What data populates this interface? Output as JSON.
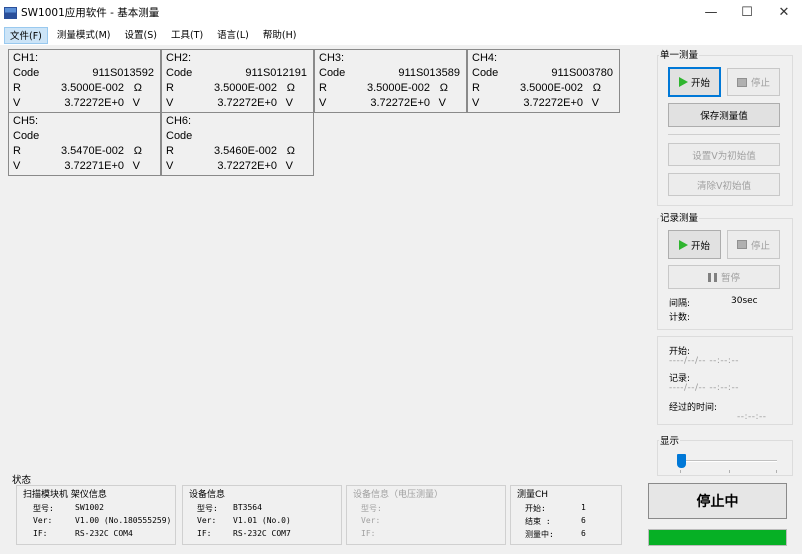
{
  "window": {
    "title": "SW1001应用软件 - 基本测量",
    "minimize_glyph": "—",
    "maximize_glyph": "☐",
    "close_glyph": "✕",
    "app_icon": "monitor-icon"
  },
  "menu": [
    "文件(F)",
    "测量模式(M)",
    "设置(S)",
    "工具(T)",
    "语言(L)",
    "帮助(H)"
  ],
  "channels": [
    {
      "name": "CH1:",
      "code_label": "Code",
      "code": "911S013592",
      "r_label": "R",
      "r": "3.5000E-002",
      "r_unit": "Ω",
      "v_label": "V",
      "v": "3.72272E+0",
      "v_unit": "V"
    },
    {
      "name": "CH2:",
      "code_label": "Code",
      "code": "911S012191",
      "r_label": "R",
      "r": "3.5000E-002",
      "r_unit": "Ω",
      "v_label": "V",
      "v": "3.72272E+0",
      "v_unit": "V"
    },
    {
      "name": "CH3:",
      "code_label": "Code",
      "code": "911S013589",
      "r_label": "R",
      "r": "3.5000E-002",
      "r_unit": "Ω",
      "v_label": "V",
      "v": "3.72272E+0",
      "v_unit": "V"
    },
    {
      "name": "CH4:",
      "code_label": "Code",
      "code": "911S003780",
      "r_label": "R",
      "r": "3.5000E-002",
      "r_unit": "Ω",
      "v_label": "V",
      "v": "3.72272E+0",
      "v_unit": "V"
    },
    {
      "name": "CH5:",
      "code_label": "Code",
      "code": "",
      "r_label": "R",
      "r": "3.5470E-002",
      "r_unit": "Ω",
      "v_label": "V",
      "v": "3.72271E+0",
      "v_unit": "V"
    },
    {
      "name": "CH6:",
      "code_label": "Code",
      "code": "",
      "r_label": "R",
      "r": "3.5460E-002",
      "r_unit": "Ω",
      "v_label": "V",
      "v": "3.72272E+0",
      "v_unit": "V"
    }
  ],
  "status": {
    "title": "状态",
    "scanner": {
      "title": "扫描模块机  架仪信息",
      "model_label": "型号:",
      "model": "SW1002",
      "ver_label": "Ver:",
      "ver": "V1.00 (No.180555259)",
      "if_label": "IF:",
      "if": "RS-232C COM4"
    },
    "device": {
      "title": "设备信息",
      "model_label": "型号:",
      "model": "BT3564",
      "ver_label": "Ver:",
      "ver": "V1.01 (No.0)",
      "if_label": "IF:",
      "if": "RS-232C COM7"
    },
    "voltage_device": {
      "title": "设备信息（电压测量）",
      "model_label": "型号:",
      "ver_label": "Ver:",
      "if_label": "IF:"
    },
    "measure_ch": {
      "title": "测量CH",
      "start_label": "开始:",
      "start": "1",
      "end_label": "结束  :",
      "end": "6",
      "current_label": "测量中:",
      "current": "6"
    }
  },
  "single": {
    "title": "单一测量",
    "start": "开始",
    "stop": "停止",
    "save": "保存测量值",
    "set_initial": "设置V为初始值",
    "clear_initial": "清除V初始值"
  },
  "record": {
    "title": "记录测量",
    "start": "开始",
    "stop": "停止",
    "pause": "暂停",
    "interval_label": "间隔:",
    "interval": "30sec",
    "count_label": "计数:"
  },
  "times": {
    "start_label": "开始:",
    "start_value": "----/--/-- --:--:--",
    "record_label": "记录:",
    "record_value": "----/--/-- --:--:--",
    "elapsed_label": "经过的时间:",
    "elapsed_value": "--:--:--"
  },
  "display": {
    "title": "显示",
    "slider_value": 0
  },
  "state": {
    "label": "停止中",
    "progress": 1.0
  },
  "colors": {
    "accent": "#0078d7",
    "progress": "#06b025",
    "play": "#2fb52f"
  }
}
